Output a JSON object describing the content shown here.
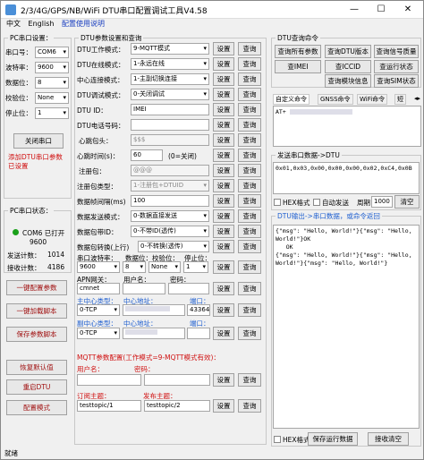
{
  "title": "2/3/4G/GPS/NB/WiFi DTU串口配置调试工具V4.58",
  "menu": {
    "chinese": "中文",
    "english": "English",
    "help": "配置使用说明"
  },
  "pc_serial": {
    "group": "PC串口设置：",
    "port_label": "串口号：",
    "port": "COM6",
    "baud_label": "波特率：",
    "baud": "9600",
    "data_label": "数据位：",
    "data": "8",
    "parity_label": "校验位：",
    "parity": "None",
    "stop_label": "停止位：",
    "stop": "1",
    "close_btn": "关闭串口",
    "note": "添加DTU串口参数 已设置"
  },
  "pc_status": {
    "group": "PC串口状态：",
    "port_state": "COM6 已打开",
    "baud": "9600",
    "sent_label": "发送计数：",
    "sent": "1014",
    "recv_label": "接收计数：",
    "recv": "4186"
  },
  "left_buttons": {
    "config": "一键配置参数",
    "load": "一键加载脚本",
    "save": "保存参数脚本",
    "restore": "恢复默认值",
    "restart": "重启DTU",
    "config_mode": "配置模式"
  },
  "dtu": {
    "group": "DTU参数设置和查询",
    "set": "设置",
    "query": "查询",
    "work_mode_label": "DTU工作模式：",
    "work_mode": "9-MQTT模式",
    "online_label": "DTU在线模式：",
    "online": "1-永远在线",
    "conn_label": "中心连接模式：",
    "conn": "1-主副切换连接",
    "debug_label": "DTU调试模式：",
    "debug": "0-关闭调试",
    "id_label": "DTU ID：",
    "id": "IMEI",
    "phone_label": "DTU电话号码：",
    "phone": "",
    "hb_label": "心跳包头：",
    "hb": "$$$",
    "hb_interval_label": "心跳时间(s)：",
    "hb_interval": "60",
    "hb_hint": "(0=关闭)",
    "reg_label": "注册包：",
    "reg": "@@@",
    "reg_type_label": "注册包类型：",
    "reg_type": "1-注册包+DTUID",
    "frame_label": "数据帧间隔(ms)",
    "frame": "100",
    "send_mode_label": "数据发送模式：",
    "send_mode": "0-数据直接发送",
    "header_label": "数据包带ID：",
    "header": "0-不带ID(透传)",
    "convert_label": "数据包转换(上行)",
    "convert": "0-不转换(透传)",
    "uart_label": "串口波特率：",
    "data_bits_label": "数据位：",
    "check_label": "校验位：",
    "stop_label": "停止位：",
    "uart": "9600",
    "data_bits": "8",
    "check": "None",
    "stop": "1",
    "apn_label": "APN网关：",
    "user_label": "用户名：",
    "pass_label": "密码：",
    "apn": "cmnet",
    "main_label": "主中心类型：",
    "main_addr_label": "中心地址：",
    "main_port_label": "端口：",
    "main_type": "0-TCP",
    "main_port": "43364",
    "sub_label": "副中心类型：",
    "sub_addr_label": "中心地址：",
    "sub_port_label": "端口：",
    "sub_type": "0-TCP",
    "mqtt_group": "MQTT参数配置(工作模式=9-MQTT模式有效)：",
    "mqtt_user_label": "用户名：",
    "mqtt_pass_label": "密码：",
    "sub_topic_label": "订阅主题：",
    "pub_topic_label": "发布主题：",
    "sub_topic": "testtopic/1",
    "pub_topic": "testtopic/2"
  },
  "query_group": {
    "title": "DTU查询命令",
    "buttons": [
      "查询所有参数",
      "查询DTU版本",
      "查询信号质量",
      "查IMEI",
      "查ICCID",
      "查运行状态",
      "查询模块信息",
      "查询SIM状态"
    ]
  },
  "custom_tabs": [
    "自定义命令",
    "GNSS命令",
    "WiFi命令",
    "短"
  ],
  "at_text": "AT+",
  "send": {
    "group": "发送串口数据->DTU",
    "content": "0x01,0x03,0x00,0x00,0x00,0x02,0xC4,0x0B",
    "hex": "HEX格式",
    "auto": "自动发送",
    "period_label": "周期",
    "period": "1000",
    "clear": "清空"
  },
  "recv": {
    "group": "DTU输出->串口数据，或命令返回",
    "content": "{\"msg\": \"Hello, World!\"}{\"msg\": \"Hello, World!\"}OK\n   OK\n{\"msg\": \"Hello, World!\"}{\"msg\": \"Hello, World!\"}{\"msg\": \"Hello, World!\"}",
    "hex": "HEX格式",
    "save": "保存运行数据",
    "clear": "接收清空"
  },
  "status": "就绪"
}
